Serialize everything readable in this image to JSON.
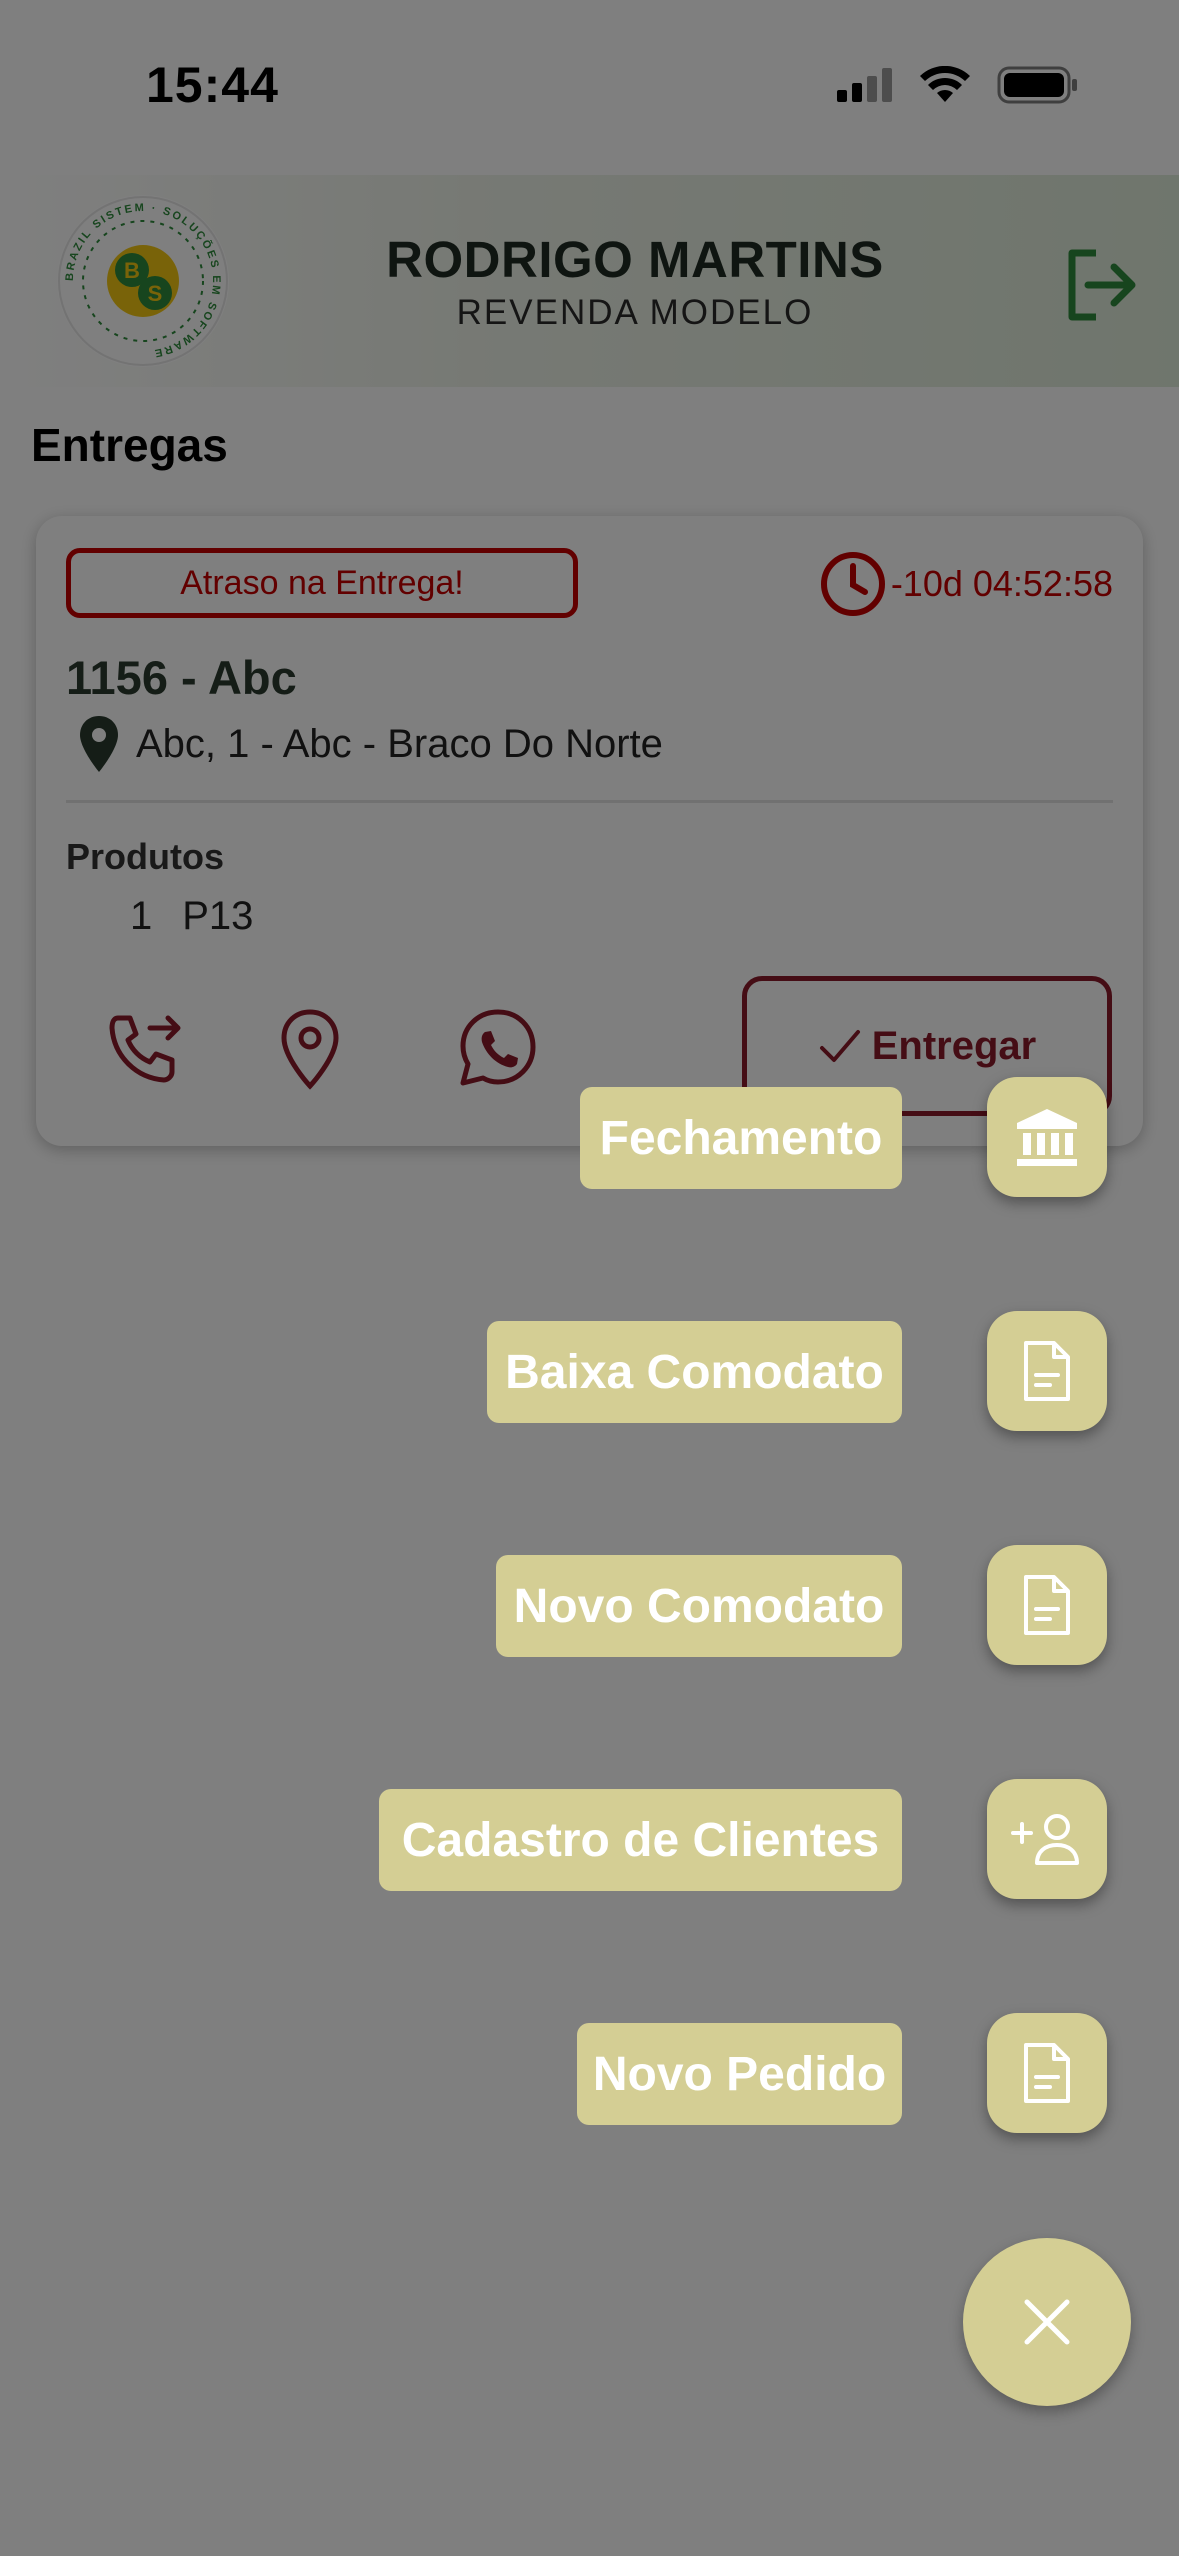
{
  "status_bar": {
    "time": "15:44",
    "icons": [
      "cellular-signal-icon",
      "wifi-icon",
      "battery-icon"
    ]
  },
  "header": {
    "user_name": "RODRIGO MARTINS",
    "subtitle": "REVENDA MODELO",
    "logo_ring_text": "BRAZIL SISTEM · SOLUÇÕES EM SOFTWARE",
    "logo_initials": [
      "B",
      "S"
    ]
  },
  "page": {
    "section_title": "Entregas"
  },
  "delivery_card": {
    "late_badge": "Atraso na Entrega!",
    "timer": "-10d 04:52:58",
    "order_id": "1156 - Abc",
    "address": "Abc, 1 - Abc - Braco Do Norte",
    "products_label": "Produtos",
    "products": [
      {
        "qty": "1",
        "name": "P13"
      }
    ],
    "deliver_label": "Entregar"
  },
  "fab_menu": {
    "items": [
      {
        "label": "Fechamento",
        "icon": "bank-icon"
      },
      {
        "label": "Baixa Comodato",
        "icon": "document-icon"
      },
      {
        "label": "Novo Comodato",
        "icon": "document-icon"
      },
      {
        "label": "Cadastro de Clientes",
        "icon": "add-person-icon"
      },
      {
        "label": "Novo Pedido",
        "icon": "document-icon"
      }
    ],
    "close_icon": "close-icon"
  },
  "colors": {
    "fab": "#d4ce94",
    "alert_red": "#c40000",
    "action_maroon": "#8a1a2a",
    "brand_green": "#2e8b3c",
    "overlay": "rgba(0,0,0,0.5)"
  }
}
